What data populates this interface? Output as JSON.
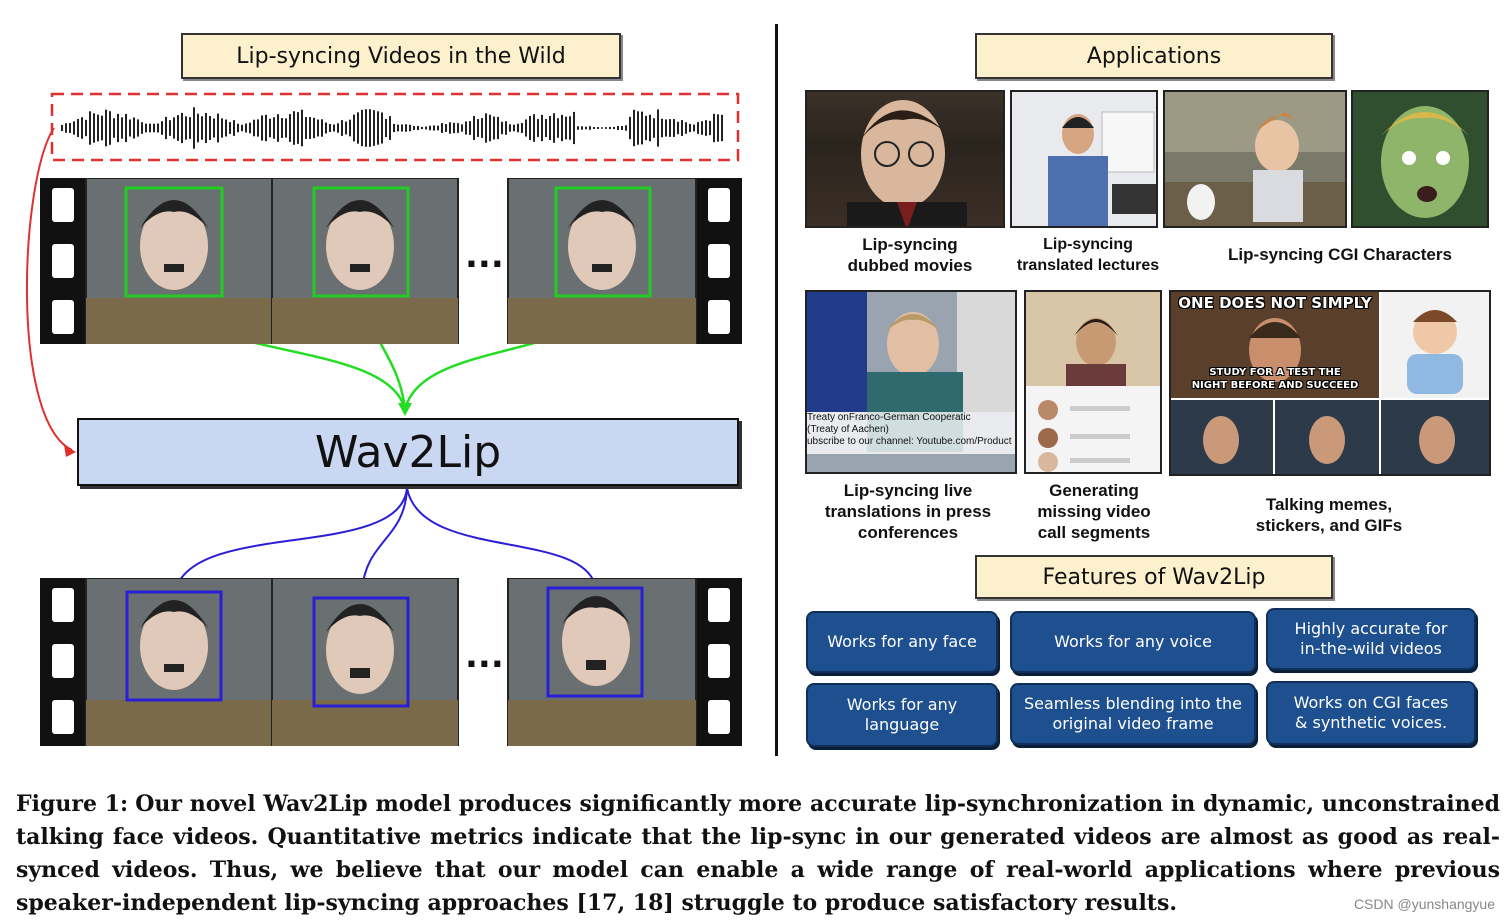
{
  "left_panel": {
    "title": "Lip-syncing Videos in the Wild",
    "model_label": "Wav2Lip",
    "ellipsis": "..."
  },
  "right_panel": {
    "applications_title": "Applications",
    "applications": [
      {
        "caption_line1": "Lip-syncing",
        "caption_line2": "dubbed movies"
      },
      {
        "caption_line1": "Lip-syncing",
        "caption_line2": "translated lectures"
      },
      {
        "caption_line1": "Lip-syncing CGI Characters",
        "caption_line2": ""
      },
      {
        "caption_line1": "Lip-syncing live",
        "caption_line2": "translations in press",
        "caption_line3": "conferences"
      },
      {
        "caption_line1": "Generating",
        "caption_line2": "missing video",
        "caption_line3": "call segments"
      },
      {
        "caption_line1": "Talking memes,",
        "caption_line2": "stickers, and GIFs"
      }
    ],
    "press_overlay": {
      "line1": "Treaty onFranco-German Cooperatic",
      "line2": "(Treaty of Aachen)",
      "line3": "ubscribe to our channel: Youtube.com/Product"
    },
    "meme_text": {
      "top": "ONE DOES NOT SIMPLY",
      "bottom1": "STUDY FOR A TEST THE",
      "bottom2": "NIGHT BEFORE AND SUCCEED"
    },
    "features_title": "Features of Wav2Lip",
    "features": [
      {
        "line1": "Works for any face",
        "line2": ""
      },
      {
        "line1": "Works for any voice",
        "line2": ""
      },
      {
        "line1": "Highly accurate for",
        "line2": "in-the-wild videos"
      },
      {
        "line1": "Works for any",
        "line2": "language"
      },
      {
        "line1": "Seamless blending into the",
        "line2": "original video frame"
      },
      {
        "line1": "Works on CGI faces",
        "line2": "& synthetic voices."
      }
    ]
  },
  "caption": {
    "label": "Figure 1:",
    "text": "Our novel Wav2Lip model produces significantly more accurate lip-synchronization in dynamic, unconstrained talking face videos. Quantitative metrics indicate that the lip-sync in our generated videos are almost as good as real-synced videos. Thus, we believe that our model can enable a wide range of real-world applications where previous speaker-independent lip-syncing approaches [17, 18] struggle to produce satisfactory results."
  },
  "watermark": "CSDN @yunshangyue",
  "colors": {
    "title_fill": "#fcf1cc",
    "model_fill": "#c9d7f3",
    "feature_fill": "#1e4f8f",
    "input_face_box": "#22cc22",
    "output_face_box": "#2a1fd6",
    "audio_box": "#e03030"
  }
}
